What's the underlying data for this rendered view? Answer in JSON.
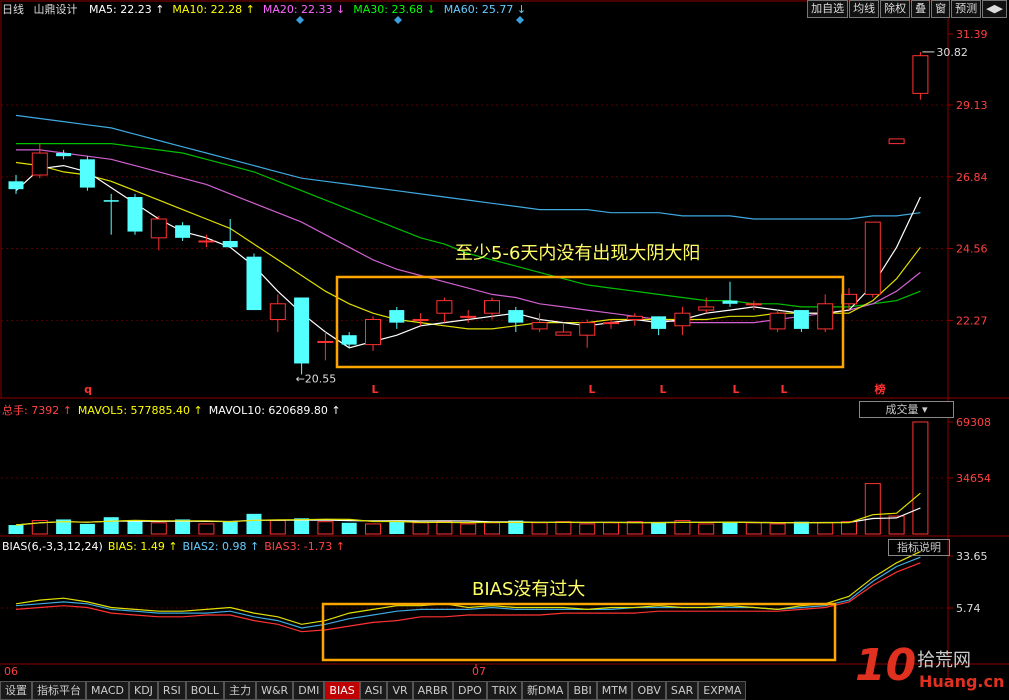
{
  "header": {
    "period": "日线",
    "stock": "山鼎设计",
    "ma": [
      {
        "label": "MA5: 22.23",
        "arrow": "↑",
        "color": "#ffffff"
      },
      {
        "label": "MA10: 22.28",
        "arrow": "↑",
        "color": "#ffff00"
      },
      {
        "label": "MA20: 22.33",
        "arrow": "↓",
        "color": "#ff66ff"
      },
      {
        "label": "MA30: 23.68",
        "arrow": "↓",
        "color": "#00ff00"
      },
      {
        "label": "MA60: 25.77",
        "arrow": "↓",
        "color": "#66ccff"
      }
    ]
  },
  "toolbar": [
    "加自选",
    "均线",
    "除权",
    "叠",
    "窗",
    "预测",
    "◀▶"
  ],
  "price_axis": [
    "31.39",
    "29.13",
    "26.84",
    "24.56",
    "22.27"
  ],
  "price_marks": {
    "high": "30.82",
    "low": "20.55"
  },
  "annotations": {
    "candle_box": "至少5-6天内没有出现大阴大阳",
    "bias_box": "BIAS没有过大",
    "markers": [
      "q",
      "L",
      "L",
      "L",
      "L",
      "L",
      "榜"
    ]
  },
  "volume_panel": {
    "total": {
      "label": "总手: 7392",
      "arrow": "↑",
      "color": "#ff4444"
    },
    "mavol5": {
      "label": "MAVOL5: 577885.40",
      "arrow": "↑",
      "color": "#ffff00"
    },
    "mavol10": {
      "label": "MAVOL10: 620689.80",
      "arrow": "↑",
      "color": "#ffffff"
    },
    "selector": "成交量",
    "axis": [
      "69308",
      "34654"
    ]
  },
  "bias_panel": {
    "title": {
      "label": "BIAS(6,-3,3,12,24)",
      "color": "#ffffff"
    },
    "b1": {
      "label": "BIAS: 1.49",
      "arrow": "↑",
      "color": "#ffff00"
    },
    "b2": {
      "label": "BIAS2: 0.98",
      "arrow": "↑",
      "color": "#66ccff"
    },
    "b3": {
      "label": "BIAS3: -1.73",
      "arrow": "↑",
      "color": "#ff4444"
    },
    "help": "指标说明",
    "axis": [
      "33.65",
      "5.74"
    ]
  },
  "date_labels": [
    "06",
    "07"
  ],
  "tabs": [
    "设置",
    "指标平台",
    "MACD",
    "KDJ",
    "RSI",
    "BOLL",
    "主力",
    "W&R",
    "DMI",
    "BIAS",
    "ASI",
    "VR",
    "ARBR",
    "DPO",
    "TRIX",
    "新DMA",
    "BBI",
    "MTM",
    "OBV",
    "SAR",
    "EXPMA"
  ],
  "active_tab": "BIAS",
  "watermark": {
    "big": "10",
    "brand": "拾荒网",
    "domain": "Huang.cn"
  },
  "chart_data": {
    "type": "candlestick",
    "ylim": [
      19.8,
      31.9
    ],
    "candles": [
      {
        "o": 26.7,
        "c": 26.45,
        "h": 26.9,
        "l": 26.3
      },
      {
        "o": 26.9,
        "c": 27.6,
        "h": 27.9,
        "l": 26.8
      },
      {
        "o": 27.6,
        "c": 27.5,
        "h": 27.7,
        "l": 27.4
      },
      {
        "o": 27.4,
        "c": 26.5,
        "h": 27.5,
        "l": 26.4
      },
      {
        "o": 26.1,
        "c": 26.05,
        "h": 26.3,
        "l": 25.0
      },
      {
        "o": 26.2,
        "c": 25.1,
        "h": 26.3,
        "l": 25.0
      },
      {
        "o": 24.9,
        "c": 25.5,
        "h": 25.6,
        "l": 24.5
      },
      {
        "o": 25.3,
        "c": 24.9,
        "h": 25.4,
        "l": 24.8
      },
      {
        "o": 24.8,
        "c": 24.8,
        "h": 25.0,
        "l": 24.6
      },
      {
        "o": 24.8,
        "c": 24.6,
        "h": 25.5,
        "l": 24.6
      },
      {
        "o": 24.3,
        "c": 22.6,
        "h": 24.4,
        "l": 22.6
      },
      {
        "o": 22.3,
        "c": 22.8,
        "h": 23.1,
        "l": 21.9
      },
      {
        "o": 23.0,
        "c": 20.9,
        "h": 23.0,
        "l": 20.55
      },
      {
        "o": 21.6,
        "c": 21.6,
        "h": 21.9,
        "l": 21.0
      },
      {
        "o": 21.8,
        "c": 21.5,
        "h": 21.9,
        "l": 21.4
      },
      {
        "o": 21.5,
        "c": 22.3,
        "h": 22.4,
        "l": 21.3
      },
      {
        "o": 22.6,
        "c": 22.2,
        "h": 22.7,
        "l": 22.0
      },
      {
        "o": 22.3,
        "c": 22.3,
        "h": 22.5,
        "l": 22.1
      },
      {
        "o": 22.5,
        "c": 22.9,
        "h": 23.0,
        "l": 22.2
      },
      {
        "o": 22.4,
        "c": 22.4,
        "h": 22.6,
        "l": 22.2
      },
      {
        "o": 22.5,
        "c": 22.9,
        "h": 23.0,
        "l": 22.3
      },
      {
        "o": 22.6,
        "c": 22.2,
        "h": 22.7,
        "l": 21.9
      },
      {
        "o": 22.0,
        "c": 22.2,
        "h": 22.5,
        "l": 21.9
      },
      {
        "o": 21.8,
        "c": 21.9,
        "h": 22.2,
        "l": 21.8
      },
      {
        "o": 21.8,
        "c": 22.2,
        "h": 22.3,
        "l": 21.4
      },
      {
        "o": 22.2,
        "c": 22.2,
        "h": 22.3,
        "l": 22.0
      },
      {
        "o": 22.3,
        "c": 22.4,
        "h": 22.5,
        "l": 22.1
      },
      {
        "o": 22.4,
        "c": 22.0,
        "h": 22.4,
        "l": 21.8
      },
      {
        "o": 22.1,
        "c": 22.5,
        "h": 22.7,
        "l": 21.8
      },
      {
        "o": 22.6,
        "c": 22.7,
        "h": 23.0,
        "l": 22.5
      },
      {
        "o": 22.9,
        "c": 22.8,
        "h": 23.5,
        "l": 22.7
      },
      {
        "o": 22.8,
        "c": 22.8,
        "h": 22.9,
        "l": 22.6
      },
      {
        "o": 22.0,
        "c": 22.5,
        "h": 22.6,
        "l": 21.9
      },
      {
        "o": 22.6,
        "c": 22.0,
        "h": 22.6,
        "l": 21.9
      },
      {
        "o": 22.0,
        "c": 22.8,
        "h": 23.1,
        "l": 21.9
      },
      {
        "o": 22.8,
        "c": 23.1,
        "h": 23.3,
        "l": 22.6
      },
      {
        "o": 23.1,
        "c": 25.4,
        "h": 25.4,
        "l": 23.0
      },
      {
        "o": 27.9,
        "c": 28.05,
        "h": 28.05,
        "l": 27.9
      },
      {
        "o": 29.5,
        "c": 30.7,
        "h": 30.82,
        "l": 29.3
      }
    ],
    "volume": [
      8,
      12,
      13,
      9,
      15,
      12,
      10,
      13,
      9,
      11,
      18,
      12,
      14,
      11,
      10,
      9,
      12,
      10,
      11,
      9,
      10,
      12,
      10,
      11,
      9,
      10,
      11,
      10,
      12,
      9,
      11,
      10,
      9,
      11,
      10,
      11,
      45,
      16,
      100
    ],
    "ma5": [
      26.4,
      27.1,
      27.2,
      27.0,
      26.5,
      26.0,
      25.5,
      25.1,
      24.9,
      24.6,
      24.0,
      23.2,
      22.5,
      21.9,
      21.4,
      21.6,
      21.8,
      22.1,
      22.2,
      22.3,
      22.4,
      22.5,
      22.3,
      22.2,
      22.1,
      22.2,
      22.3,
      22.2,
      22.3,
      22.5,
      22.6,
      22.7,
      22.6,
      22.5,
      22.5,
      22.6,
      23.4,
      24.6,
      26.2
    ],
    "ma10": [
      27.3,
      27.2,
      27.0,
      26.9,
      26.7,
      26.4,
      26.1,
      25.8,
      25.5,
      25.2,
      24.7,
      24.2,
      23.7,
      23.2,
      22.8,
      22.5,
      22.3,
      22.2,
      22.1,
      22.0,
      22.0,
      22.1,
      22.2,
      22.2,
      22.2,
      22.3,
      22.3,
      22.3,
      22.3,
      22.3,
      22.4,
      22.4,
      22.5,
      22.5,
      22.5,
      22.5,
      22.9,
      23.6,
      24.6
    ],
    "ma20": [
      27.7,
      27.7,
      27.6,
      27.5,
      27.4,
      27.2,
      27.0,
      26.8,
      26.6,
      26.3,
      26.0,
      25.7,
      25.4,
      25.0,
      24.6,
      24.2,
      23.9,
      23.7,
      23.5,
      23.3,
      23.1,
      23.0,
      22.8,
      22.7,
      22.6,
      22.5,
      22.4,
      22.3,
      22.2,
      22.2,
      22.2,
      22.2,
      22.3,
      22.4,
      22.5,
      22.6,
      22.8,
      23.2,
      23.8
    ],
    "ma30": [
      27.9,
      27.9,
      27.9,
      27.9,
      27.9,
      27.8,
      27.7,
      27.6,
      27.4,
      27.2,
      27.0,
      26.7,
      26.4,
      26.1,
      25.8,
      25.5,
      25.2,
      24.9,
      24.7,
      24.4,
      24.2,
      24.0,
      23.8,
      23.6,
      23.4,
      23.3,
      23.2,
      23.1,
      23.0,
      22.9,
      22.9,
      22.8,
      22.8,
      22.7,
      22.7,
      22.7,
      22.8,
      22.9,
      23.2
    ],
    "ma60": [
      28.8,
      28.7,
      28.6,
      28.5,
      28.4,
      28.2,
      28.0,
      27.8,
      27.6,
      27.4,
      27.2,
      27.0,
      26.8,
      26.7,
      26.6,
      26.5,
      26.4,
      26.3,
      26.2,
      26.1,
      26.0,
      25.9,
      25.8,
      25.8,
      25.8,
      25.7,
      25.7,
      25.7,
      25.6,
      25.6,
      25.6,
      25.5,
      25.5,
      25.5,
      25.5,
      25.5,
      25.6,
      25.6,
      25.7
    ],
    "bias1": [
      8,
      10,
      11,
      9,
      6,
      5,
      4,
      4,
      5,
      6,
      3,
      1,
      -3,
      -1,
      3,
      5,
      7,
      7,
      8,
      6,
      7,
      6,
      6,
      6,
      5,
      6,
      6,
      7,
      6,
      6,
      7,
      6,
      5,
      7,
      8,
      12,
      22,
      30,
      36
    ],
    "bias2": [
      7,
      8,
      9,
      8,
      5,
      4,
      3,
      3,
      3,
      4,
      1,
      -1,
      -5,
      -3,
      0,
      2,
      4,
      5,
      5,
      5,
      6,
      5,
      5,
      5,
      5,
      5,
      6,
      6,
      6,
      6,
      6,
      6,
      5,
      6,
      7,
      10,
      20,
      28,
      33
    ],
    "bias3": [
      5,
      6,
      7,
      6,
      3,
      2,
      1,
      1,
      2,
      2,
      -1,
      -3,
      -7,
      -6,
      -4,
      -2,
      -1,
      1,
      1,
      2,
      2,
      2,
      2,
      3,
      3,
      3,
      3,
      4,
      4,
      4,
      4,
      4,
      4,
      5,
      6,
      9,
      18,
      25,
      30
    ]
  }
}
